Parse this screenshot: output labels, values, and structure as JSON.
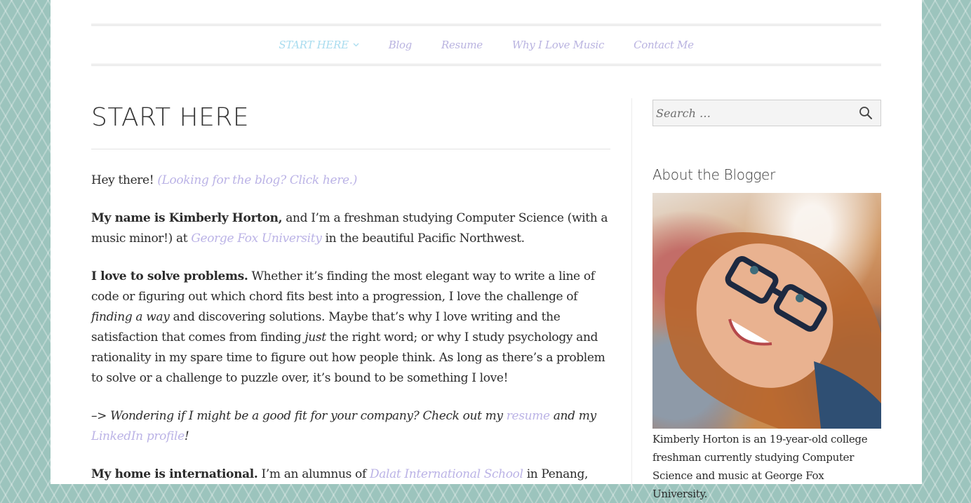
{
  "nav": {
    "items": [
      {
        "label": "START HERE",
        "active": true
      },
      {
        "label": "Blog"
      },
      {
        "label": "Resume"
      },
      {
        "label": "Why I Love Music"
      },
      {
        "label": "Contact Me"
      }
    ],
    "dropdown_icon": "chevron-down-icon"
  },
  "main": {
    "title": "START HERE",
    "p1": {
      "text": "Hey there! ",
      "link": "(Looking for the blog? Click here.)"
    },
    "p2": {
      "bold": "My name is Kimberly Horton,",
      "text1": " and I’m a freshman studying Computer Science (with a music minor!) at ",
      "link": "George Fox University",
      "text2": " in the beautiful Pacific Northwest."
    },
    "p3": {
      "bold": "I love to solve problems.",
      "text1": " Whether it’s finding the most elegant way to write a line of code or figuring out which chord fits best into a progression, I love the challenge of ",
      "em1": "finding a way",
      "text2": " and discovering solutions. Maybe that’s why I love writing and the satisfaction that comes from finding ",
      "em2": "just",
      "text3": " the right word; or why I study psychology and rationality in my spare time to figure out how people think. As long as there’s a problem to solve or a challenge to puzzle over, it’s bound to be something I love!"
    },
    "p4": {
      "text1": "–> Wondering if I might be a good fit for your company? Check out my ",
      "link1": "resume",
      "text2": " and my ",
      "link2": "LinkedIn profile",
      "text3": "!"
    },
    "p5": {
      "bold": "My home is international.",
      "text1": " I’m an alumnus of ",
      "link": "Dalat International School",
      "text2": " in Penang,"
    }
  },
  "sidebar": {
    "search_placeholder": "Search …",
    "search_icon": "search-icon",
    "widget_title": "About the Blogger",
    "caption": "Kimberly Horton is an 19-year-old college freshman currently studying Computer Science and music at George Fox University."
  },
  "colors": {
    "link": "#bbb3e6",
    "active_nav": "#a8dcef",
    "background": "#9cc4bd"
  }
}
